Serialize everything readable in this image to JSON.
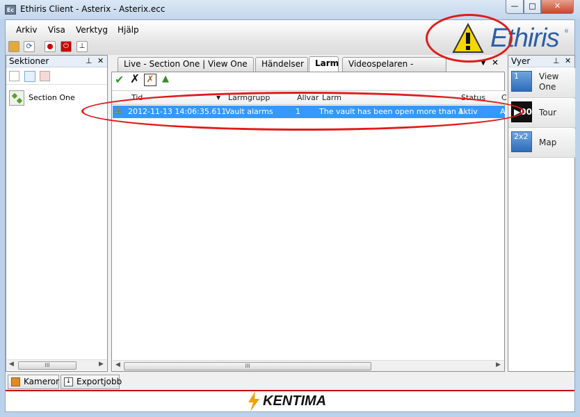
{
  "window": {
    "title": "Ethiris Client - Asterix - Asterix.ecc",
    "app_icon": "Ec"
  },
  "menu": [
    "Arkiv",
    "Visa",
    "Verktyg",
    "Hjälp"
  ],
  "brand": {
    "name": "Ethiris",
    "reg": "®"
  },
  "sections_pane": {
    "title": "Sektioner",
    "items": [
      "Section One"
    ]
  },
  "tabs": [
    "Live - Section One | View One",
    "Händelser",
    "Larm",
    "Videospelaren - Dynamisk"
  ],
  "alarm_grid": {
    "columns": [
      "Tid",
      "Larmgrupp",
      "Allvar",
      "Larm",
      "Status",
      "C"
    ],
    "rows": [
      {
        "time": "2012-11-13 14:06:35.611",
        "group": "Vault alarms",
        "severity": "1",
        "alarm": "The vault has been open more than 1 ...",
        "status": "Aktiv",
        "extra": "A"
      }
    ]
  },
  "views_pane": {
    "title": "Vyer",
    "items": [
      {
        "icon_text": "1",
        "label": "View One"
      },
      {
        "icon_text": "▶00",
        "label": "Tour"
      },
      {
        "icon_text": "2x2",
        "label": "Map"
      }
    ]
  },
  "bottom_tabs": [
    "Kameror",
    "Exportjobb"
  ],
  "footer": {
    "brand": "KENTIMA"
  },
  "colors": {
    "accent": "#3399ff",
    "brand_blue": "#2a5ea8",
    "annotation_red": "#e11b1b"
  }
}
